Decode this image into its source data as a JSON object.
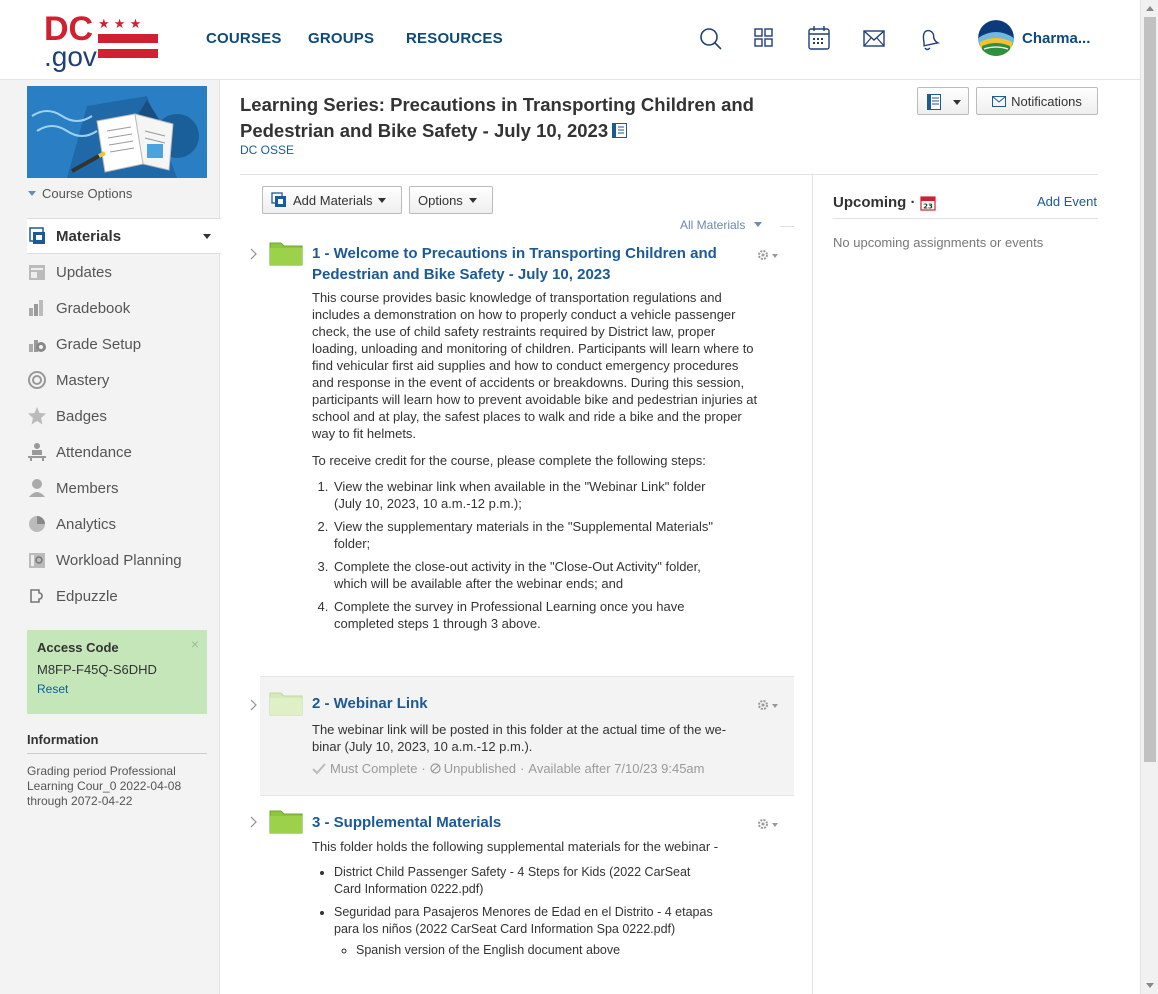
{
  "nav": {
    "logo_text": "DC.gov",
    "links": [
      "COURSES",
      "GROUPS",
      "RESOURCES"
    ],
    "icons": [
      "search-icon",
      "apps-grid-icon",
      "calendar-icon",
      "mail-icon",
      "bell-icon"
    ],
    "user_name": "Charma..."
  },
  "sidebar": {
    "course_options": "Course Options",
    "items": [
      {
        "label": "Materials",
        "icon": "materials-icon"
      },
      {
        "label": "Updates",
        "icon": "updates-icon"
      },
      {
        "label": "Gradebook",
        "icon": "gradebook-icon"
      },
      {
        "label": "Grade Setup",
        "icon": "grade-setup-icon"
      },
      {
        "label": "Mastery",
        "icon": "mastery-icon"
      },
      {
        "label": "Badges",
        "icon": "badges-icon"
      },
      {
        "label": "Attendance",
        "icon": "attendance-icon"
      },
      {
        "label": "Members",
        "icon": "members-icon"
      },
      {
        "label": "Analytics",
        "icon": "analytics-icon"
      },
      {
        "label": "Workload Planning",
        "icon": "workload-icon"
      },
      {
        "label": "Edpuzzle",
        "icon": "edpuzzle-icon"
      }
    ],
    "access_code": {
      "label": "Access Code",
      "code": "M8FP-F45Q-S6DHD",
      "reset": "Reset",
      "close": "×"
    },
    "information": {
      "heading": "Information",
      "body": "Grading period Professional Learning Cour_0 2022-04-08 through 2072-04-22"
    }
  },
  "header": {
    "title": "Learning Series: Precautions in Transporting Children and Pedestrian and Bike Safety - July 10, 2023",
    "org": "DC OSSE",
    "notifications": "Notifications"
  },
  "toolbar": {
    "add_materials": "Add Materials",
    "options": "Options",
    "all_materials": "All Materials"
  },
  "folders": [
    {
      "title": "1 - Welcome to Precautions in Transporting Children and Pedestrian and Bike Safety - July 10, 2023",
      "description": "This course provides basic knowledge of transportation regulations and includes a demonstration on how to properly conduct a vehicle passenger check, the use of child safety restraints required by District law, proper loading, unloading and monitoring of children. Participants will learn where to find vehicular first aid supplies and how to conduct emergency procedures and response in the event of accidents or breakdowns. During this session, participants will learn how to prevent avoidable bike and pedestrian injuries at school and at play, the safest places to walk and ride a bike and the proper way to fit helmets.",
      "steps_intro": "To receive credit for the course, please complete the following steps:",
      "steps": [
        "View the webinar link when available in the \"Webinar Link\" folder (July 10, 2023, 10 a.m.-12 p.m.);",
        "View the supplementary materials in the \"Supplemental Materials\" folder;",
        "Complete the close-out activity in the \"Close-Out Activity\" folder, which will be available after the webinar ends; and",
        "Complete the survey in Professional Learning once you have completed steps 1 through 3 above."
      ]
    },
    {
      "title": "2 - Webinar Link",
      "description": "The webinar link will be posted in this folder at the actual time of the we-binar (July 10, 2023, 10 a.m.-12 p.m.).",
      "meta_complete": "Must Complete",
      "meta_sep": "·",
      "meta_unpublished": "Unpublished",
      "meta_available": "Available after 7/10/23 9:45am"
    },
    {
      "title": "3 - Supplemental Materials",
      "description": "This folder holds the following supplemental materials for the webinar -",
      "items": [
        "District Child Passenger Safety - 4 Steps for Kids (2022 CarSeat Card Information 0222.pdf)",
        "Seguridad para Pasajeros Menores de Edad en el Distrito - 4 etapas para los niños (2022 CarSeat Card Information Spa 0222.pdf)"
      ],
      "sub_item": "Spanish version of the English document above"
    }
  ],
  "upcoming": {
    "title": "Upcoming ·",
    "add_event": "Add Event",
    "empty": "No upcoming assignments or events",
    "calendar_day": "23"
  },
  "colors": {
    "brand_red": "#d1202f",
    "nav_blue": "#0b4a7a",
    "link_blue": "#1c5a96",
    "folder_green": "#8cc63f",
    "access_green": "#c5e6b9"
  }
}
